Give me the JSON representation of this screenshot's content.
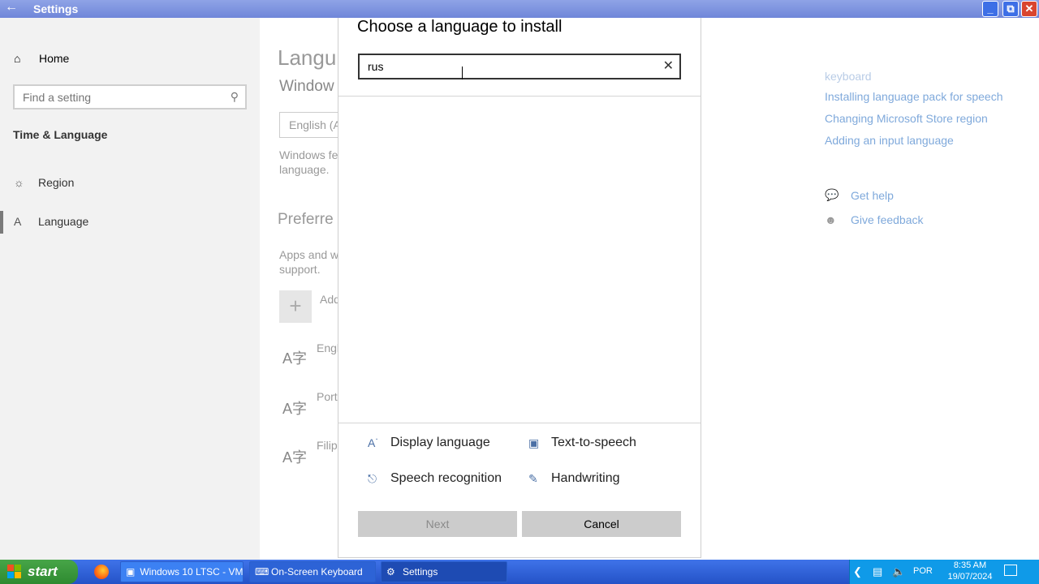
{
  "window": {
    "title": "Settings"
  },
  "nav": {
    "home": "Home",
    "search_placeholder": "Find a setting",
    "section": "Time & Language",
    "items": [
      {
        "label": "Region",
        "icon": "globe-icon"
      },
      {
        "label": "Language",
        "icon": "language-icon",
        "active": true
      }
    ]
  },
  "background": {
    "heading": "Langu",
    "subheading": "Window",
    "select_value": "English (A",
    "text_1a": "Windows fe",
    "text_1b": "language.",
    "preferred": "Preferre",
    "text_2a": "Apps and w",
    "text_2b": "support.",
    "add_label": "Add",
    "languages": [
      "Engl",
      "Port",
      "Filip"
    ]
  },
  "related": {
    "partial_link": "keyboard",
    "links": [
      "Installing language pack for speech",
      "Changing Microsoft Store region",
      "Adding an input language"
    ],
    "help": "Get help",
    "feedback": "Give feedback"
  },
  "dialog": {
    "title": "Choose a language to install",
    "search_value": "rus",
    "features": [
      {
        "label": "Display language",
        "icon": "display-language-icon"
      },
      {
        "label": "Text-to-speech",
        "icon": "text-to-speech-icon"
      },
      {
        "label": "Speech recognition",
        "icon": "microphone-icon"
      },
      {
        "label": "Handwriting",
        "icon": "handwriting-icon"
      }
    ],
    "next_label": "Next",
    "cancel_label": "Cancel"
  },
  "taskbar": {
    "start_label": "start",
    "tasks": [
      "Windows 10 LTSC - VM...",
      "On-Screen Keyboard",
      "Settings"
    ],
    "lang": "POR",
    "time": "8:35 AM",
    "date": "19/07/2024"
  }
}
